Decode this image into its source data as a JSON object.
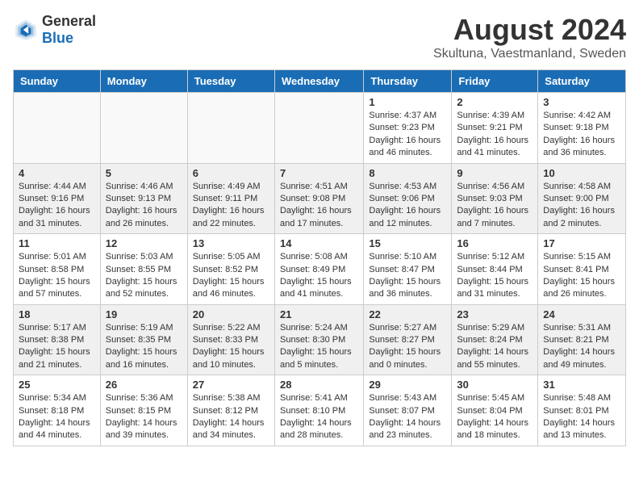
{
  "header": {
    "logo_general": "General",
    "logo_blue": "Blue",
    "month_year": "August 2024",
    "location": "Skultuna, Vaestmanland, Sweden"
  },
  "weekdays": [
    "Sunday",
    "Monday",
    "Tuesday",
    "Wednesday",
    "Thursday",
    "Friday",
    "Saturday"
  ],
  "weeks": [
    [
      {
        "day": "",
        "info": ""
      },
      {
        "day": "",
        "info": ""
      },
      {
        "day": "",
        "info": ""
      },
      {
        "day": "",
        "info": ""
      },
      {
        "day": "1",
        "info": "Sunrise: 4:37 AM\nSunset: 9:23 PM\nDaylight: 16 hours\nand 46 minutes."
      },
      {
        "day": "2",
        "info": "Sunrise: 4:39 AM\nSunset: 9:21 PM\nDaylight: 16 hours\nand 41 minutes."
      },
      {
        "day": "3",
        "info": "Sunrise: 4:42 AM\nSunset: 9:18 PM\nDaylight: 16 hours\nand 36 minutes."
      }
    ],
    [
      {
        "day": "4",
        "info": "Sunrise: 4:44 AM\nSunset: 9:16 PM\nDaylight: 16 hours\nand 31 minutes."
      },
      {
        "day": "5",
        "info": "Sunrise: 4:46 AM\nSunset: 9:13 PM\nDaylight: 16 hours\nand 26 minutes."
      },
      {
        "day": "6",
        "info": "Sunrise: 4:49 AM\nSunset: 9:11 PM\nDaylight: 16 hours\nand 22 minutes."
      },
      {
        "day": "7",
        "info": "Sunrise: 4:51 AM\nSunset: 9:08 PM\nDaylight: 16 hours\nand 17 minutes."
      },
      {
        "day": "8",
        "info": "Sunrise: 4:53 AM\nSunset: 9:06 PM\nDaylight: 16 hours\nand 12 minutes."
      },
      {
        "day": "9",
        "info": "Sunrise: 4:56 AM\nSunset: 9:03 PM\nDaylight: 16 hours\nand 7 minutes."
      },
      {
        "day": "10",
        "info": "Sunrise: 4:58 AM\nSunset: 9:00 PM\nDaylight: 16 hours\nand 2 minutes."
      }
    ],
    [
      {
        "day": "11",
        "info": "Sunrise: 5:01 AM\nSunset: 8:58 PM\nDaylight: 15 hours\nand 57 minutes."
      },
      {
        "day": "12",
        "info": "Sunrise: 5:03 AM\nSunset: 8:55 PM\nDaylight: 15 hours\nand 52 minutes."
      },
      {
        "day": "13",
        "info": "Sunrise: 5:05 AM\nSunset: 8:52 PM\nDaylight: 15 hours\nand 46 minutes."
      },
      {
        "day": "14",
        "info": "Sunrise: 5:08 AM\nSunset: 8:49 PM\nDaylight: 15 hours\nand 41 minutes."
      },
      {
        "day": "15",
        "info": "Sunrise: 5:10 AM\nSunset: 8:47 PM\nDaylight: 15 hours\nand 36 minutes."
      },
      {
        "day": "16",
        "info": "Sunrise: 5:12 AM\nSunset: 8:44 PM\nDaylight: 15 hours\nand 31 minutes."
      },
      {
        "day": "17",
        "info": "Sunrise: 5:15 AM\nSunset: 8:41 PM\nDaylight: 15 hours\nand 26 minutes."
      }
    ],
    [
      {
        "day": "18",
        "info": "Sunrise: 5:17 AM\nSunset: 8:38 PM\nDaylight: 15 hours\nand 21 minutes."
      },
      {
        "day": "19",
        "info": "Sunrise: 5:19 AM\nSunset: 8:35 PM\nDaylight: 15 hours\nand 16 minutes."
      },
      {
        "day": "20",
        "info": "Sunrise: 5:22 AM\nSunset: 8:33 PM\nDaylight: 15 hours\nand 10 minutes."
      },
      {
        "day": "21",
        "info": "Sunrise: 5:24 AM\nSunset: 8:30 PM\nDaylight: 15 hours\nand 5 minutes."
      },
      {
        "day": "22",
        "info": "Sunrise: 5:27 AM\nSunset: 8:27 PM\nDaylight: 15 hours\nand 0 minutes."
      },
      {
        "day": "23",
        "info": "Sunrise: 5:29 AM\nSunset: 8:24 PM\nDaylight: 14 hours\nand 55 minutes."
      },
      {
        "day": "24",
        "info": "Sunrise: 5:31 AM\nSunset: 8:21 PM\nDaylight: 14 hours\nand 49 minutes."
      }
    ],
    [
      {
        "day": "25",
        "info": "Sunrise: 5:34 AM\nSunset: 8:18 PM\nDaylight: 14 hours\nand 44 minutes."
      },
      {
        "day": "26",
        "info": "Sunrise: 5:36 AM\nSunset: 8:15 PM\nDaylight: 14 hours\nand 39 minutes."
      },
      {
        "day": "27",
        "info": "Sunrise: 5:38 AM\nSunset: 8:12 PM\nDaylight: 14 hours\nand 34 minutes."
      },
      {
        "day": "28",
        "info": "Sunrise: 5:41 AM\nSunset: 8:10 PM\nDaylight: 14 hours\nand 28 minutes."
      },
      {
        "day": "29",
        "info": "Sunrise: 5:43 AM\nSunset: 8:07 PM\nDaylight: 14 hours\nand 23 minutes."
      },
      {
        "day": "30",
        "info": "Sunrise: 5:45 AM\nSunset: 8:04 PM\nDaylight: 14 hours\nand 18 minutes."
      },
      {
        "day": "31",
        "info": "Sunrise: 5:48 AM\nSunset: 8:01 PM\nDaylight: 14 hours\nand 13 minutes."
      }
    ]
  ]
}
